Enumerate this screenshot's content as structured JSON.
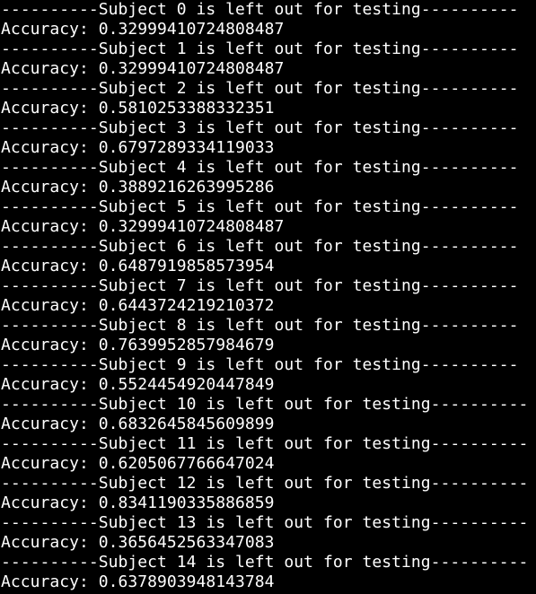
{
  "terminal": {
    "background": "#000000",
    "foreground": "#ffffff",
    "lines": [
      "----------Subject 0 is left out for testing----------",
      "Accuracy: 0.32999410724808487",
      "----------Subject 1 is left out for testing----------",
      "Accuracy: 0.32999410724808487",
      "----------Subject 2 is left out for testing----------",
      "Accuracy: 0.5810253388332351",
      "----------Subject 3 is left out for testing----------",
      "Accuracy: 0.6797289334119033",
      "----------Subject 4 is left out for testing----------",
      "Accuracy: 0.3889216263995286",
      "----------Subject 5 is left out for testing----------",
      "Accuracy: 0.32999410724808487",
      "----------Subject 6 is left out for testing----------",
      "Accuracy: 0.6487919858573954",
      "----------Subject 7 is left out for testing----------",
      "Accuracy: 0.6443724219210372",
      "----------Subject 8 is left out for testing----------",
      "Accuracy: 0.7639952857984679",
      "----------Subject 9 is left out for testing----------",
      "Accuracy: 0.5524454920447849",
      "----------Subject 10 is left out for testing----------",
      "Accuracy: 0.6832645845609899",
      "----------Subject 11 is left out for testing----------",
      "Accuracy: 0.6205067766647024",
      "----------Subject 12 is left out for testing----------",
      "Accuracy: 0.8341190335886859",
      "----------Subject 13 is left out for testing----------",
      "Accuracy: 0.3656452563347083",
      "----------Subject 14 is left out for testing----------",
      "Accuracy: 0.6378903948143784"
    ]
  }
}
